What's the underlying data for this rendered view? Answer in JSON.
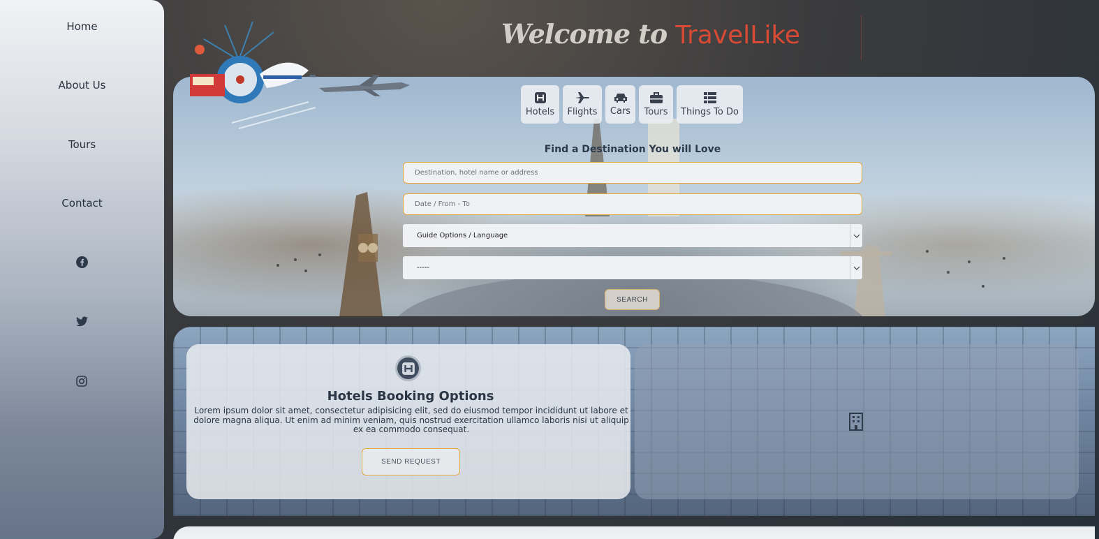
{
  "sidebar": {
    "items": [
      {
        "label": "Home"
      },
      {
        "label": "About Us"
      },
      {
        "label": "Tours"
      },
      {
        "label": "Contact"
      }
    ],
    "social": [
      "facebook-icon",
      "twitter-icon",
      "instagram-icon"
    ]
  },
  "header": {
    "welcome": "Welcome to",
    "brand": "TravelLike",
    "brand_color": "#d94a35"
  },
  "search": {
    "tabs": [
      {
        "label": "Hotels",
        "icon": "hotel-icon"
      },
      {
        "label": "Flights",
        "icon": "plane-icon"
      },
      {
        "label": "Cars",
        "icon": "car-icon"
      },
      {
        "label": "Tours",
        "icon": "briefcase-icon"
      },
      {
        "label": "Things To Do",
        "icon": "list-icon"
      }
    ],
    "title": "Find a Destination You will Love",
    "destination_placeholder": "Destination, hotel name or address",
    "date_placeholder": "Date / From - To",
    "guide_select": "Guide Options / Language",
    "guests_select": "-----",
    "button": "SEARCH"
  },
  "booking": {
    "title": "Hotels Booking Options",
    "text": "Lorem ipsum dolor sit amet, consectetur adipisicing elit, sed do eiusmod tempor incididunt ut labore et dolore magna aliqua. Ut enim ad minim veniam, quis nostrud exercitation ullamco laboris nisi ut aliquip ex ea commodo consequat.",
    "button": "SEND REQUEST"
  },
  "colors": {
    "accent_border": "#e0a93a",
    "text_dark": "#2b3645"
  }
}
